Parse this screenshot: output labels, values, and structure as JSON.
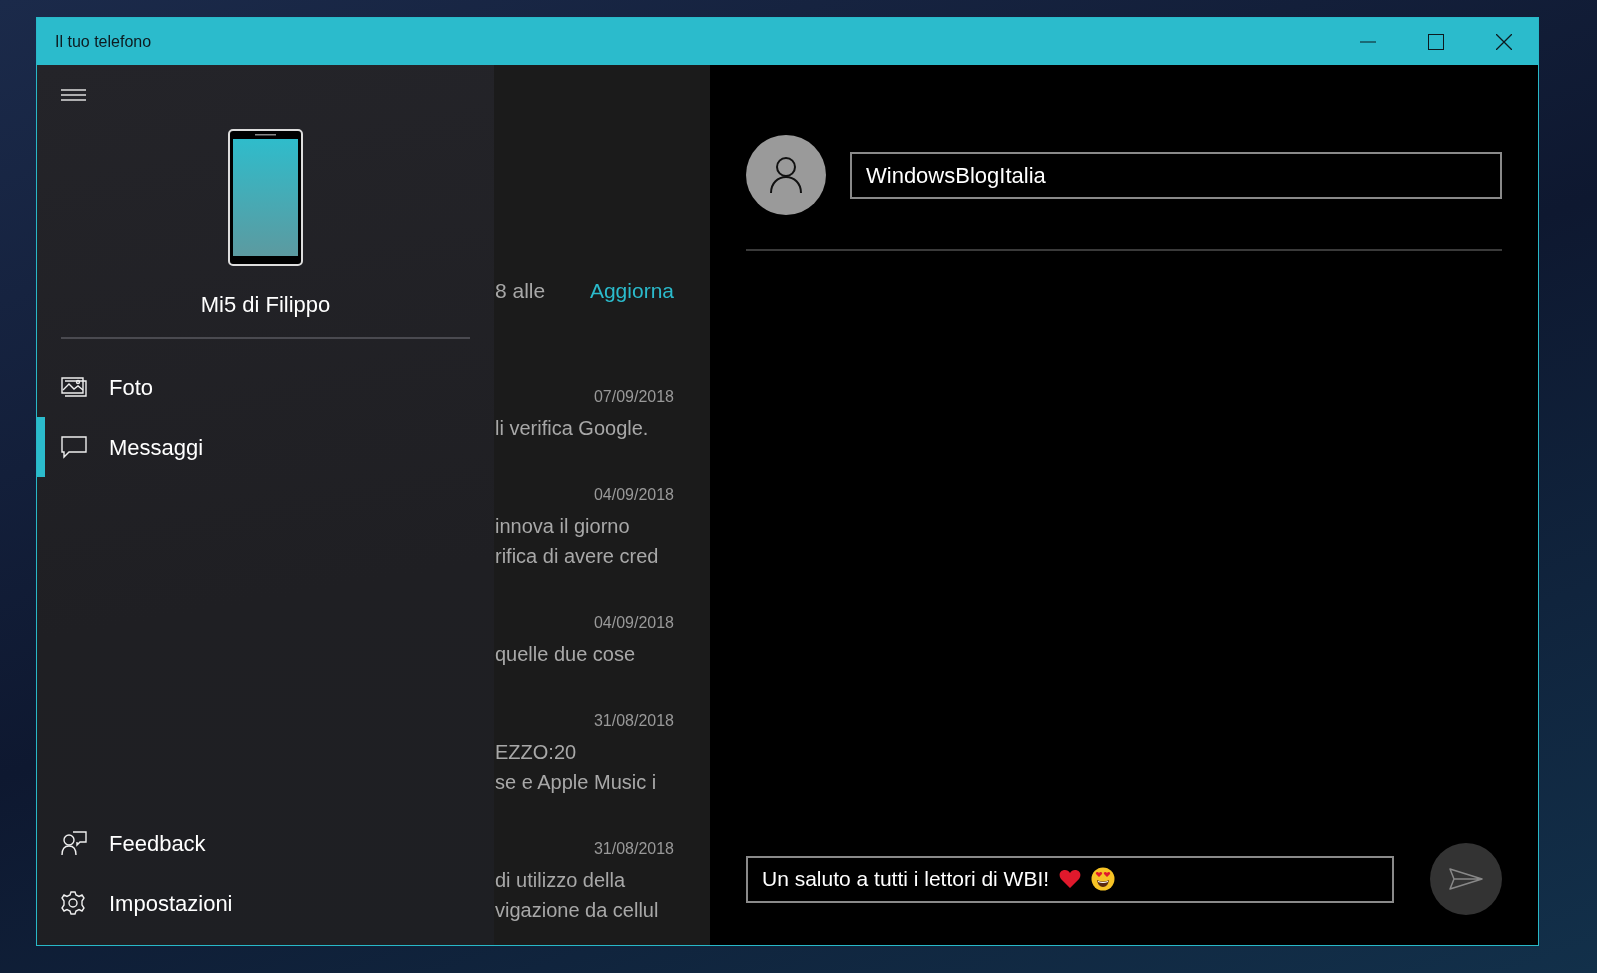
{
  "window": {
    "title": "Il tuo telefono"
  },
  "nav": {
    "device_name": "Mi5 di Filippo",
    "items": [
      {
        "label": "Foto",
        "kind": "photos",
        "selected": false
      },
      {
        "label": "Messaggi",
        "kind": "messages",
        "selected": true
      }
    ],
    "footer_items": [
      {
        "label": "Feedback",
        "kind": "feedback"
      },
      {
        "label": "Impostazioni",
        "kind": "settings"
      }
    ]
  },
  "conversations": {
    "sync_text": "8 alle",
    "refresh_link": "Aggiorna",
    "items": [
      {
        "date": "07/09/2018",
        "lines": [
          "li verifica Google."
        ]
      },
      {
        "date": "04/09/2018",
        "lines": [
          "innova il giorno",
          "rifica di avere cred"
        ]
      },
      {
        "date": "04/09/2018",
        "lines": [
          "quelle due cose"
        ]
      },
      {
        "date": "31/08/2018",
        "lines": [
          "EZZO:20",
          "se e Apple Music i"
        ]
      },
      {
        "date": "31/08/2018",
        "lines": [
          "di utilizzo della",
          "vigazione da cellul"
        ]
      }
    ]
  },
  "chat": {
    "recipient": "WindowsBlogItalia",
    "message": "Un saluto a tutti i lettori di WBI!"
  }
}
